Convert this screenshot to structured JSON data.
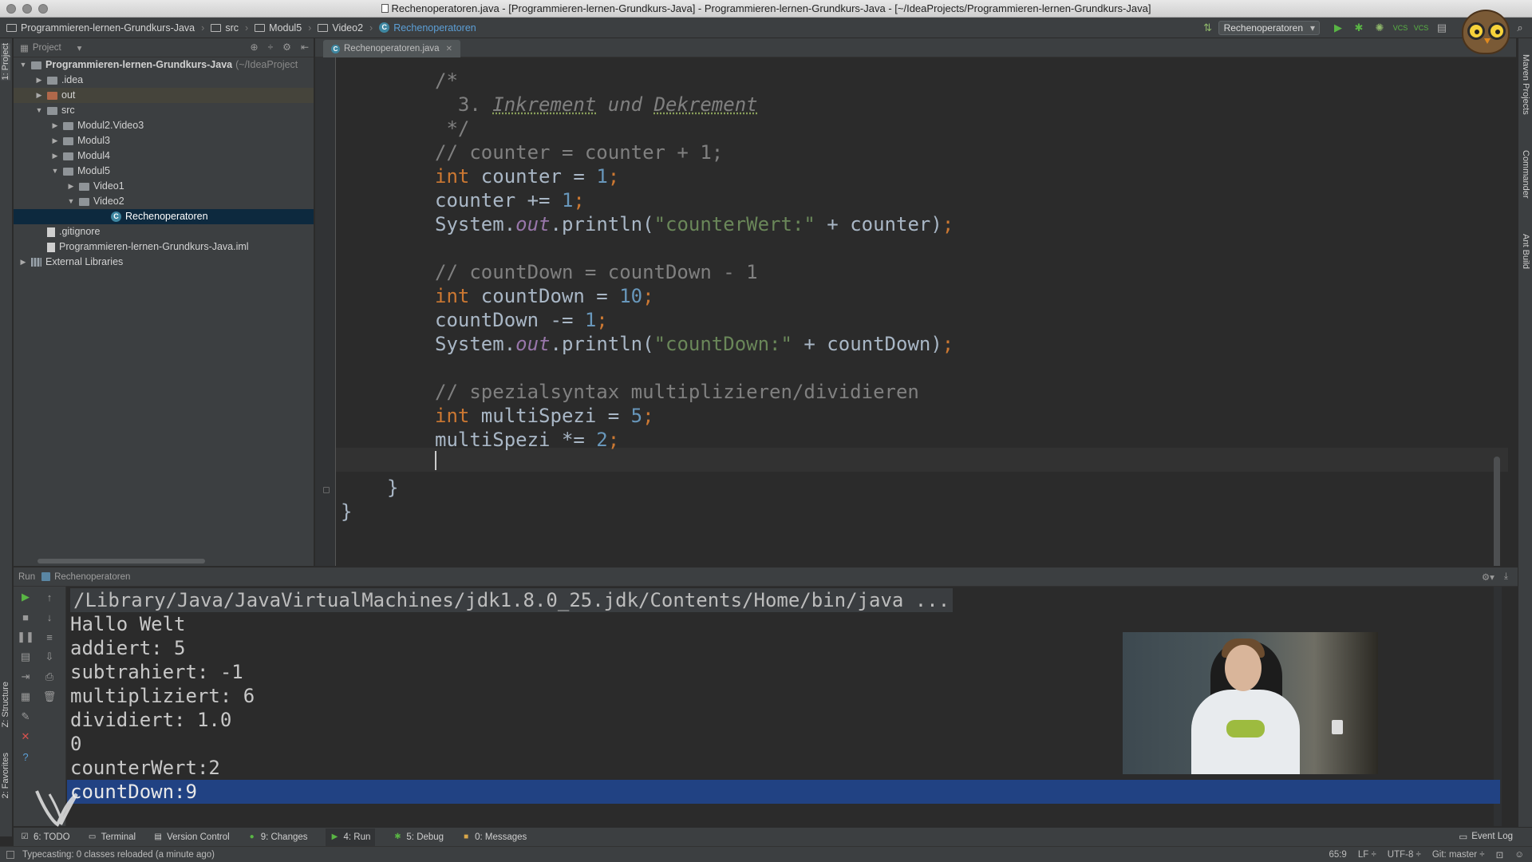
{
  "window": {
    "title": "Rechenoperatoren.java - [Programmieren-lernen-Grundkurs-Java] - Programmieren-lernen-Grundkurs-Java - [~/IdeaProjects/Programmieren-lernen-Grundkurs-Java]"
  },
  "navbar": {
    "crumbs": [
      "Programmieren-lernen-Grundkurs-Java",
      "src",
      "Modul5",
      "Video2",
      "Rechenoperatoren"
    ],
    "run_config": "Rechenoperatoren"
  },
  "left_strip": {
    "project_tab": "1: Project",
    "structure_tab": "Z: Structure",
    "favorites_tab": "2: Favorites"
  },
  "right_strip": {
    "maven_tab": "Maven Projects",
    "commander_tab": "Commander",
    "ant_tab": "Ant Build"
  },
  "project_panel": {
    "header": "Project",
    "tree": [
      {
        "label": "Programmieren-lernen-Grundkurs-Java",
        "suffix": "(~/IdeaProject",
        "depth": 0,
        "arrow": "▼",
        "icon": "folder",
        "bold": true
      },
      {
        "label": ".idea",
        "depth": 1,
        "arrow": "▶",
        "icon": "folder"
      },
      {
        "label": "out",
        "depth": 1,
        "arrow": "▶",
        "icon": "folder-red",
        "highlight": true
      },
      {
        "label": "src",
        "depth": 1,
        "arrow": "▼",
        "icon": "folder"
      },
      {
        "label": "Modul2.Video3",
        "depth": 2,
        "arrow": "▶",
        "icon": "folder"
      },
      {
        "label": "Modul3",
        "depth": 2,
        "arrow": "▶",
        "icon": "folder"
      },
      {
        "label": "Modul4",
        "depth": 2,
        "arrow": "▶",
        "icon": "folder"
      },
      {
        "label": "Modul5",
        "depth": 2,
        "arrow": "▼",
        "icon": "folder"
      },
      {
        "label": "Video1",
        "depth": 3,
        "arrow": "▶",
        "icon": "folder"
      },
      {
        "label": "Video2",
        "depth": 3,
        "arrow": "▼",
        "icon": "folder"
      },
      {
        "label": "Rechenoperatoren",
        "depth": 5,
        "arrow": "",
        "icon": "class",
        "selected": true
      },
      {
        "label": ".gitignore",
        "depth": 1,
        "arrow": "",
        "icon": "file"
      },
      {
        "label": "Programmieren-lernen-Grundkurs-Java.iml",
        "depth": 1,
        "arrow": "",
        "icon": "file"
      },
      {
        "label": "External Libraries",
        "depth": 0,
        "arrow": "▶",
        "icon": "library"
      }
    ]
  },
  "editor": {
    "tab": "Rechenoperatoren.java",
    "lines": [
      "/*",
      "  3. Inkrement und Dekrement",
      " */",
      "// counter = counter + 1;",
      "int counter = 1;",
      "counter += 1;",
      "System.out.println(\"counterWert:\" + counter);",
      "",
      "// countDown = countDown - 1",
      "int countDown = 10;",
      "countDown -= 1;",
      "System.out.println(\"countDown:\" + countDown);",
      "",
      "// spezialsyntax multiplizieren/dividieren",
      "int multiSpezi = 5;",
      "multiSpezi *= 2;",
      "",
      "}",
      "}"
    ]
  },
  "run_panel": {
    "label": "Run",
    "config": "Rechenoperatoren",
    "output": [
      "/Library/Java/JavaVirtualMachines/jdk1.8.0_25.jdk/Contents/Home/bin/java ...",
      "Hallo Welt",
      "addiert: 5",
      "subtrahiert: -1",
      "multipliziert: 6",
      "dividiert: 1.0",
      "0",
      "counterWert:2",
      "countDown:9"
    ]
  },
  "bottom_toolbar": {
    "todo": "6: TODO",
    "terminal": "Terminal",
    "vcs": "Version Control",
    "changes": "9: Changes",
    "run": "4: Run",
    "debug": "5: Debug",
    "messages": "0: Messages",
    "event_log": "Event Log"
  },
  "status": {
    "message": "Typecasting: 0 classes reloaded (a minute ago)",
    "position": "65:9",
    "line_sep": "LF ÷",
    "encoding": "UTF-8 ÷",
    "git": "Git: master ÷"
  }
}
